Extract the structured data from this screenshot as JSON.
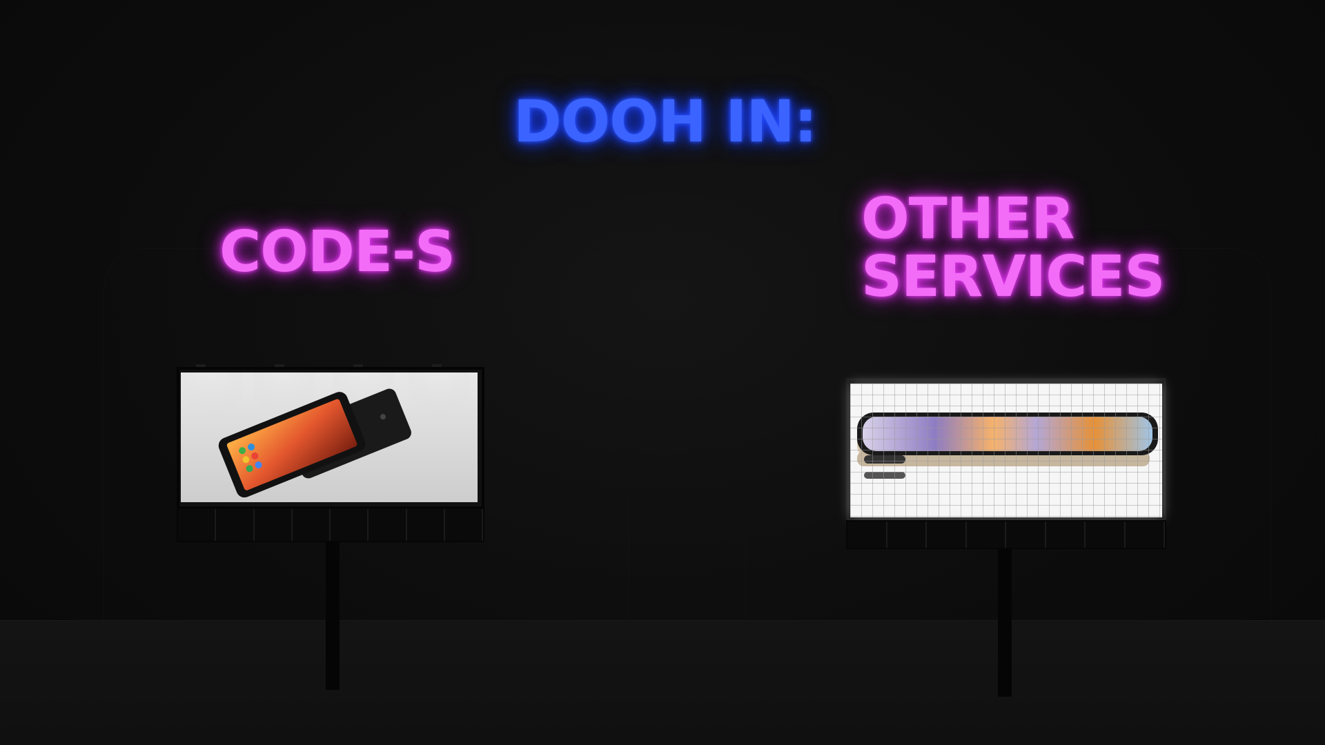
{
  "scene": {
    "heading": "DOOH IN:",
    "left_label": "CODE-S",
    "right_label_line1": "OTHER",
    "right_label_line2": "SERVICES"
  },
  "colors": {
    "heading_neon": "#3b63ff",
    "label_neon": "#f36cf7",
    "background": "#0b0b0b"
  },
  "billboards": [
    {
      "name": "left",
      "content": "smartphone-advert-image"
    },
    {
      "name": "right",
      "content": "smartphone-advert-image"
    }
  ]
}
